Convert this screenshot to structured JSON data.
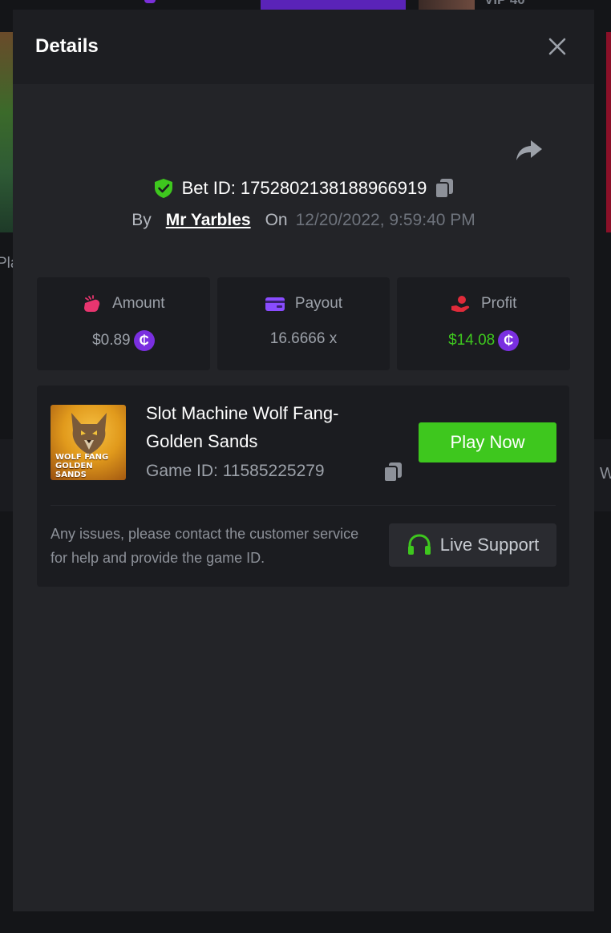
{
  "background": {
    "vip_label": "VIP 40",
    "left_fragment": "Pla",
    "right_fragment": "W"
  },
  "modal": {
    "title": "Details",
    "bet_id": "Bet ID: 1752802138188966919",
    "by_label": "By",
    "user": "Mr Yarbles",
    "on_label": "On",
    "date": "12/20/2022, 9:59:40 PM"
  },
  "stats": {
    "amount_label": "Amount",
    "amount_value": "$0.89",
    "payout_label": "Payout",
    "payout_value": "16.6666 x",
    "profit_label": "Profit",
    "profit_value": "$14.08",
    "coin_symbol": "₵"
  },
  "game": {
    "name": "Slot Machine Wolf Fang-Golden Sands",
    "id": "Game ID: 11585225279",
    "thumb_text_line1": "WOLF FANG",
    "thumb_text_line2": "GOLDEN SANDS",
    "play_label": "Play Now"
  },
  "support": {
    "issues_text": "Any issues, please contact the customer service for help and provide the game ID.",
    "button_label": "Live Support"
  },
  "colors": {
    "accent_green": "#3ec71e",
    "coin_purple": "#7a2fe0",
    "profit_green": "#3ec71e"
  }
}
